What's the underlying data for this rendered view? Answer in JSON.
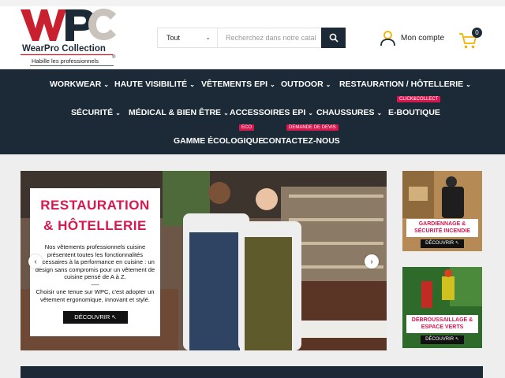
{
  "brand": {
    "logo_letters": "WPC",
    "name": "WearPro Collection",
    "tagline": "Habille les professionnels",
    "colors": {
      "red": "#c8202f",
      "navy": "#1b2a36",
      "accent": "#d8174f",
      "grey": "#c9c3bb"
    }
  },
  "search": {
    "category": "Tout",
    "placeholder": "Recherchez dans notre catalogue",
    "value": ""
  },
  "account": {
    "label": "Mon compte"
  },
  "cart": {
    "count": "0"
  },
  "nav": {
    "row1": [
      {
        "label": "WORKWEAR",
        "has_menu": true
      },
      {
        "label": "HAUTE VISIBILITÉ",
        "has_menu": true
      },
      {
        "label": "VÊTEMENTS EPI",
        "has_menu": true
      },
      {
        "label": "OUTDOOR",
        "has_menu": true
      },
      {
        "label": "RESTAURATION / HÔTELLERIE",
        "has_menu": true
      }
    ],
    "row2": [
      {
        "label": "SÉCURITÉ",
        "has_menu": true
      },
      {
        "label": "MÉDICAL & BIEN ÊTRE",
        "has_menu": true
      },
      {
        "label": "ACCESSOIRES EPI",
        "has_menu": true
      },
      {
        "label": "CHAUSSURES",
        "has_menu": true
      },
      {
        "label": "E-BOUTIQUE",
        "has_menu": false,
        "tag": "CLICK&COLLECT"
      }
    ],
    "row3": [
      {
        "label": "GAMME ÉCOLOGIQUE",
        "has_menu": false,
        "tag": "ECO"
      },
      {
        "label": "CONTACTEZ-NOUS",
        "has_menu": false,
        "tag": "DEMANDE DE DEVIS"
      }
    ]
  },
  "hero": {
    "title_line1": "RESTAURATION",
    "title_line2": "& HÔTELLERIE",
    "body_1": "Nos vêtements professionnels cuisine présentent toutes les fonctionnalités nécessaires à la performance en cuisine : un design sans compromis pour un vêtement de cuisine pensé de A à Z.",
    "separator": "----",
    "body_2": "Choisir une tenue sur WPC, c'est adopter un vêtement ergonomique, innovant et stylé.",
    "cta": "DÉCOUVRIR"
  },
  "side_banners": [
    {
      "label": "GARDIENNAGE & SÉCURITÉ INCENDIE",
      "cta": "DÉCOUVRIR"
    },
    {
      "label": "DÉBROUSSAILLAGE & ESPACE VERTS",
      "cta": "DÉCOUVRIR"
    }
  ]
}
